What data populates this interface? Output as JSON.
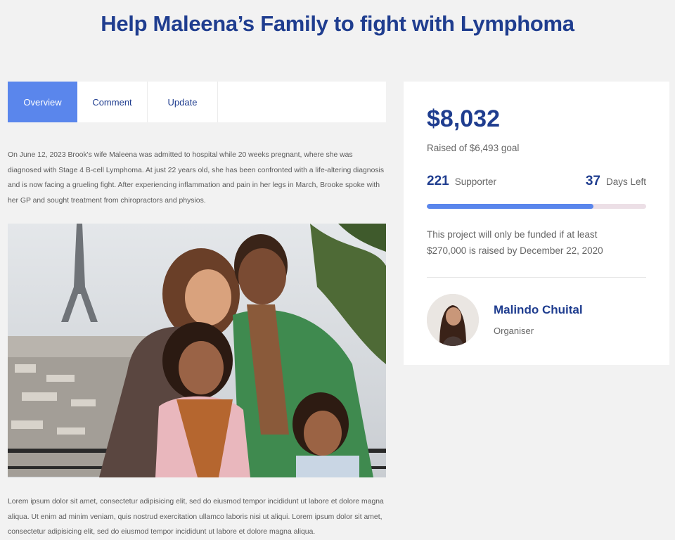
{
  "page": {
    "title": "Help Maleena’s Family to fight with Lymphoma"
  },
  "tabs": [
    {
      "label": "Overview",
      "active": true
    },
    {
      "label": "Comment",
      "active": false
    },
    {
      "label": "Update",
      "active": false
    }
  ],
  "content": {
    "intro": "On June 12, 2023 Brook's wife Maleena was admitted to hospital while 20 weeks pregnant, where she was diagnosed with Stage 4 B-cell Lymphoma. At just 22 years old, she has been confronted with a life-altering diagnosis and is now facing a grueling fight. After experiencing inflammation and pain in her legs in March, Brooke spoke with her GP and sought treatment from chiropractors and physios.",
    "lorem": "Lorem ipsum dolor sit amet, consectetur adipisicing elit, sed do eiusmod tempor incididunt ut labore et dolore magna aliqua. Ut enim ad minim veniam, quis nostrud exercitation ullamco laboris nisi ut aliqui. Lorem ipsum dolor sit amet, consectetur adipisicing elit, sed do eiusmod tempor incididunt ut labore et dolore magna aliqua."
  },
  "campaign": {
    "raised": "$8,032",
    "goal_text": "Raised of $6,493 goal",
    "supporters": "221",
    "supporters_label": "Supporter",
    "days_left": "37",
    "days_left_label": "Days Left",
    "progress_fraction": 0.76,
    "notice": "This project will only be funded if at least $270,000 is raised by December 22, 2020"
  },
  "organiser": {
    "name": "Malindo Chuital",
    "role": "Organiser"
  },
  "colors": {
    "brand": "#1f3d8f",
    "accent": "#5a86ec",
    "track": "#ecdfe6",
    "background": "#f2f2f2"
  }
}
